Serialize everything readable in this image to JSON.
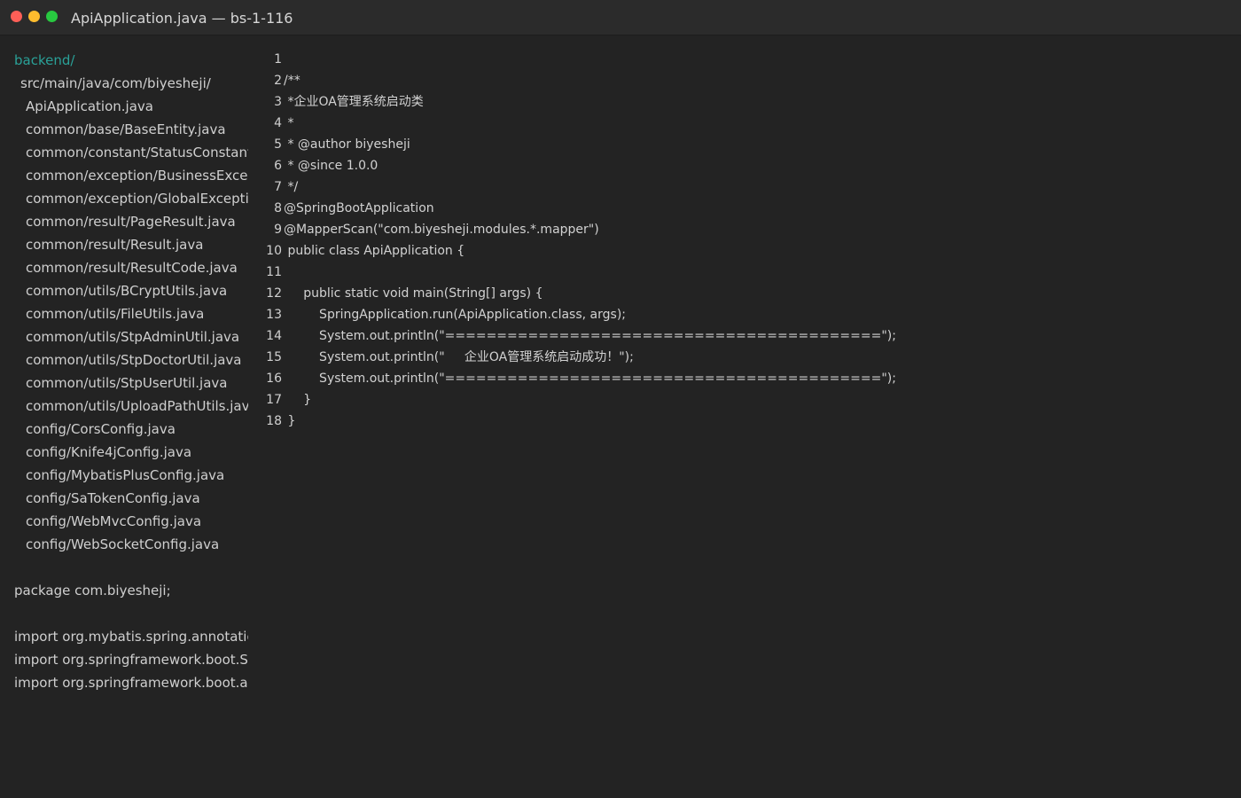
{
  "window": {
    "title": "ApiApplication.java — bs-1-116",
    "colors": {
      "close": "#ff5f57",
      "minimize": "#febc2e",
      "zoom": "#28c840",
      "accent": "#2aa198",
      "background": "#232323"
    }
  },
  "sidebar": {
    "root": "backend/",
    "src": "src/main/java/com/biyesheji/",
    "files": [
      "ApiApplication.java",
      "common/base/BaseEntity.java",
      "common/constant/StatusConstant.java",
      "common/exception/BusinessException.java",
      "common/exception/GlobalExceptionHandler.java",
      "common/result/PageResult.java",
      "common/result/Result.java",
      "common/result/ResultCode.java",
      "common/utils/BCryptUtils.java",
      "common/utils/FileUtils.java",
      "common/utils/StpAdminUtil.java",
      "common/utils/StpDoctorUtil.java",
      "common/utils/StpUserUtil.java",
      "common/utils/UploadPathUtils.java",
      "config/CorsConfig.java",
      "config/Knife4jConfig.java",
      "config/MybatisPlusConfig.java",
      "config/SaTokenConfig.java",
      "config/WebMvcConfig.java",
      "config/WebSocketConfig.java"
    ],
    "preview": [
      "package com.biyesheji;",
      "import org.mybatis.spring.annotation",
      "import org.springframework.boot.Spr",
      "import org.springframework.boot.aut"
    ]
  },
  "editor": {
    "lines": [
      {
        "no": "1",
        "text": ""
      },
      {
        "no": "2",
        "text": "/**"
      },
      {
        "no": "3",
        "text": " *企业OA管理系统启动类"
      },
      {
        "no": "4",
        "text": " *"
      },
      {
        "no": "5",
        "text": " * @author biyesheji"
      },
      {
        "no": "6",
        "text": " * @since 1.0.0"
      },
      {
        "no": "7",
        "text": " */"
      },
      {
        "no": "8",
        "text": "@SpringBootApplication"
      },
      {
        "no": "9",
        "text": "@MapperScan(\"com.biyesheji.modules.*.mapper\")"
      },
      {
        "no": "10",
        "text": " public class ApiApplication {"
      },
      {
        "no": "11",
        "text": ""
      },
      {
        "no": "12",
        "text": "     public static void main(String[] args) {"
      },
      {
        "no": "13",
        "text": "         SpringApplication.run(ApiApplication.class, args);"
      },
      {
        "no": "14",
        "text": "         System.out.println(\"==========================================\");"
      },
      {
        "no": "15",
        "text": "         System.out.println(\"     企业OA管理系统启动成功！\");"
      },
      {
        "no": "16",
        "text": "         System.out.println(\"==========================================\");"
      },
      {
        "no": "17",
        "text": "     }"
      },
      {
        "no": "18",
        "text": " }"
      }
    ]
  }
}
